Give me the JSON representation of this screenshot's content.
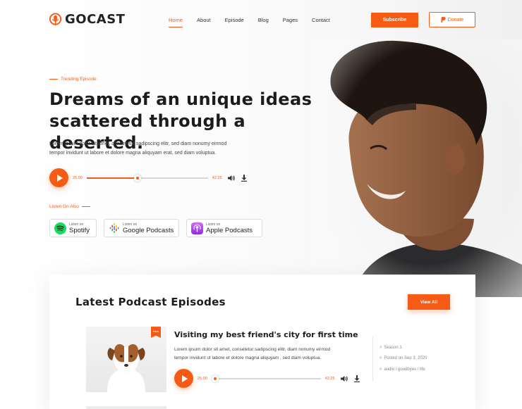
{
  "brand": {
    "name": "GOCAST"
  },
  "nav": {
    "items": [
      "Home",
      "About",
      "Episode",
      "Blog",
      "Pages",
      "Contact"
    ],
    "active": "Home"
  },
  "header": {
    "subscribe_label": "Subscribe",
    "donate_label": "Donate"
  },
  "hero": {
    "eyebrow": "Trending Episode",
    "title_line1": "Dreams of an unique ideas",
    "title_line2": "scattered through a deserted.",
    "desc_line1": "Lorem ipsum dolor sit amet, consetetur sadipscing elitr, sed diam nonumy eirmod",
    "desc_line2": "tempor invidunt ut labore et dolore magna aliquyam erat, sed diam voluptua.",
    "player": {
      "current_time": "25.00",
      "total_time": "42.25",
      "progress": 0.42
    },
    "listen_on": "Listen On Also",
    "platforms": [
      {
        "small": "Listen on",
        "big": "Spotify"
      },
      {
        "small": "Listen on",
        "big": "Google Podcasts"
      },
      {
        "small": "Listen on",
        "big": "Apple Podcasts"
      }
    ]
  },
  "episodes": {
    "section_title": "Latest Podcast Episodes",
    "view_all_label": "View All",
    "items": [
      {
        "tag": "New",
        "title": "Visiting my best friend's city for first time",
        "desc_line1": "Lorem ipsum dolor sit amet, consetetur sadipscing elitr, diam nonumy eirmod",
        "desc_line2": "tempor invidunt ut labore et dolore magna aliquyam , sed diam voluptua.",
        "player": {
          "current_time": "25.00",
          "total_time": "42.25",
          "progress": 0.0
        },
        "meta": {
          "season": "Season 1",
          "posted": "Posted on Sep 3, 2020",
          "tags": "audio / goodbyes / life"
        }
      }
    ]
  },
  "colors": {
    "accent": "#f55b14",
    "text": "#1c1c1c",
    "muted": "#888888"
  },
  "icons": {
    "volume": "volume-icon",
    "download": "download-icon",
    "donate": "paypal-icon",
    "logo": "microphone-icon"
  }
}
